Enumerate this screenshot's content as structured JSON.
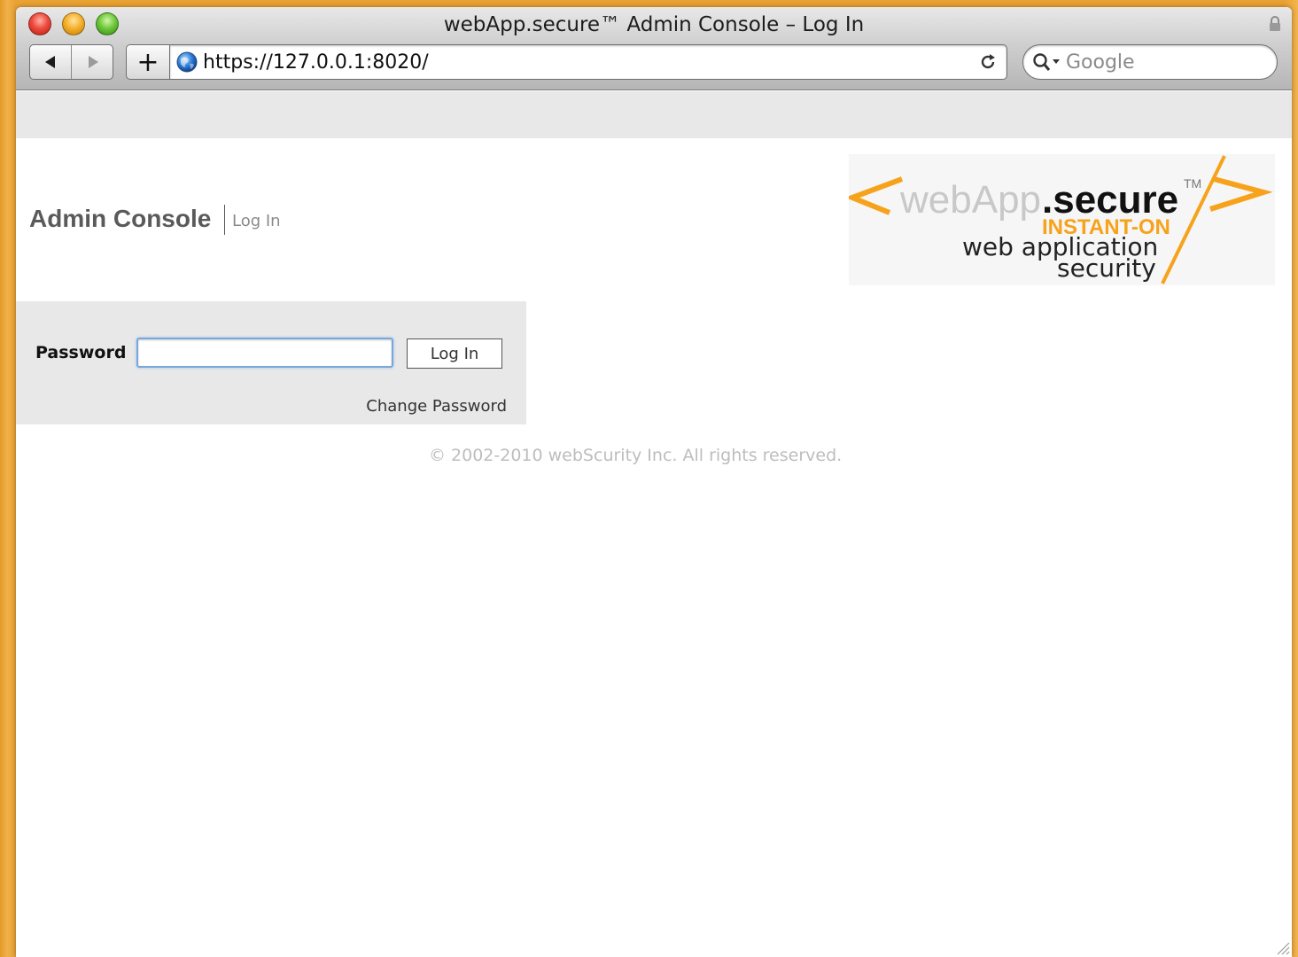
{
  "window": {
    "title": "webApp.secure™ Admin Console – Log In"
  },
  "toolbar": {
    "back_icon": "back-arrow-icon",
    "forward_icon": "forward-arrow-icon",
    "add_label": "+",
    "url": "https://127.0.0.1:8020/",
    "search_placeholder": "Google"
  },
  "header": {
    "title": "Admin Console",
    "subtitle": "Log In"
  },
  "logo": {
    "brand_light": "webApp",
    "brand_bold": ".secure",
    "tm": "TM",
    "tagline_accent": "INSTANT-ON",
    "tagline_line1": "web application",
    "tagline_line2": "security",
    "accent_color": "#f7a21b"
  },
  "login": {
    "password_label": "Password",
    "password_value": "",
    "submit_label": "Log In",
    "change_password_label": "Change Password"
  },
  "footer": {
    "copyright": "© 2002-2010 webScurity Inc. All rights reserved."
  },
  "colors": {
    "desktop": "#e9a233",
    "panel_bg": "#e8e8e8",
    "focus_ring": "#7aa7db"
  }
}
